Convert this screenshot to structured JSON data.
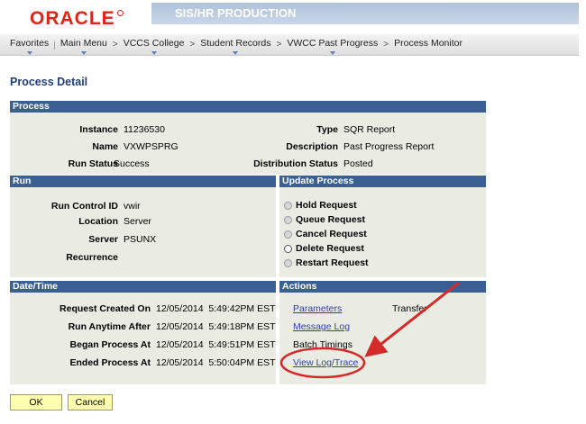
{
  "header": {
    "logo_text": "ORACLE",
    "environment": "SIS/HR PRODUCTION"
  },
  "nav": {
    "favorites": "Favorites",
    "main_menu": "Main Menu",
    "crumbs": [
      "VCCS College",
      "Student Records",
      "VWCC Past Progress",
      "Process Monitor"
    ],
    "separator": ">"
  },
  "page_title": "Process Detail",
  "process": {
    "header": "Process",
    "instance_label": "Instance",
    "instance_value": "11236530",
    "type_label": "Type",
    "type_value": "SQR Report",
    "name_label": "Name",
    "name_value": "VXWPSPRG",
    "description_label": "Description",
    "description_value": "Past Progress Report",
    "run_status_label": "Run Status",
    "run_status_value": "Success",
    "distribution_status_label": "Distribution Status",
    "distribution_status_value": "Posted"
  },
  "run": {
    "header": "Run",
    "run_control_id_label": "Run Control ID",
    "run_control_id_value": "vwir",
    "location_label": "Location",
    "location_value": "Server",
    "server_label": "Server",
    "server_value": "PSUNX",
    "recurrence_label": "Recurrence",
    "recurrence_value": ""
  },
  "update_process": {
    "header": "Update Process",
    "options": [
      "Hold Request",
      "Queue Request",
      "Cancel Request",
      "Delete Request",
      "Restart Request"
    ]
  },
  "datetime": {
    "header": "Date/Time",
    "request_created_label": "Request Created On",
    "request_created_value": "12/05/2014  5:49:42PM EST",
    "run_anytime_label": "Run Anytime After",
    "run_anytime_value": "12/05/2014  5:49:18PM EST",
    "began_label": "Began Process At",
    "began_value": "12/05/2014  5:49:51PM EST",
    "ended_label": "Ended Process At",
    "ended_value": "12/05/2014  5:50:04PM EST"
  },
  "actions": {
    "header": "Actions",
    "parameters": "Parameters",
    "transfer": "Transfer",
    "message_log": "Message Log",
    "batch_timings": "Batch Timings",
    "view_log_trace": "View Log/Trace"
  },
  "buttons": {
    "ok": "OK",
    "cancel": "Cancel"
  },
  "colors": {
    "panel_header": "#3a5f92",
    "panel_body": "#eaece4",
    "link": "#2f3ea6",
    "annotation": "#d62a2a"
  }
}
